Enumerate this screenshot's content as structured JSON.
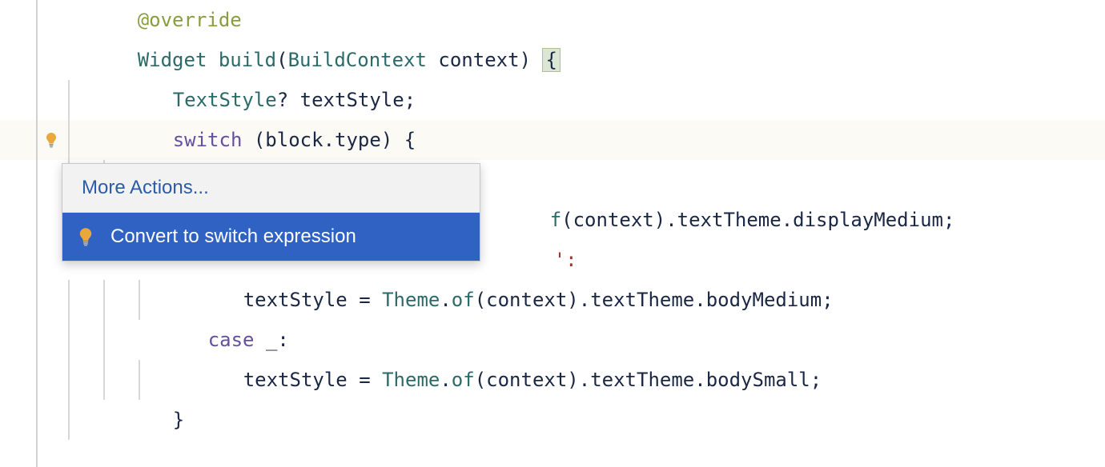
{
  "code": {
    "line1": {
      "annotation": "@override"
    },
    "line2": {
      "type1": "Widget",
      "method": "build",
      "paren_open": "(",
      "type2": "BuildContext",
      "param": "context",
      "paren_close": ") ",
      "brace": "{"
    },
    "line3": {
      "type": "TextStyle",
      "nullable": "?",
      "var": " textStyle",
      "semi": ";"
    },
    "line4": {
      "keyword": "switch",
      "rest": " (block",
      "dot": ".",
      "prop": "type",
      "close": ") {"
    },
    "line5_partial": {
      "suffix": "f(context).textTheme.displayMedium;"
    },
    "line6_partial": {
      "suffix": "':"
    },
    "line7": {
      "var": "textStyle = ",
      "type": "Theme",
      "dot1": ".",
      "method": "of",
      "args": "(context)",
      "dot2": ".",
      "p1": "textTheme",
      "dot3": ".",
      "p2": "bodyMedium",
      "semi": ";"
    },
    "line8": {
      "keyword": "case",
      "wildcard": " _",
      "colon": ":"
    },
    "line9": {
      "var": "textStyle = ",
      "type": "Theme",
      "dot1": ".",
      "method": "of",
      "args": "(context)",
      "dot2": ".",
      "p1": "textTheme",
      "dot3": ".",
      "p2": "bodySmall",
      "semi": ";"
    },
    "line10": {
      "brace": "}"
    }
  },
  "popup": {
    "header": "More Actions...",
    "action": "Convert to switch expression"
  }
}
